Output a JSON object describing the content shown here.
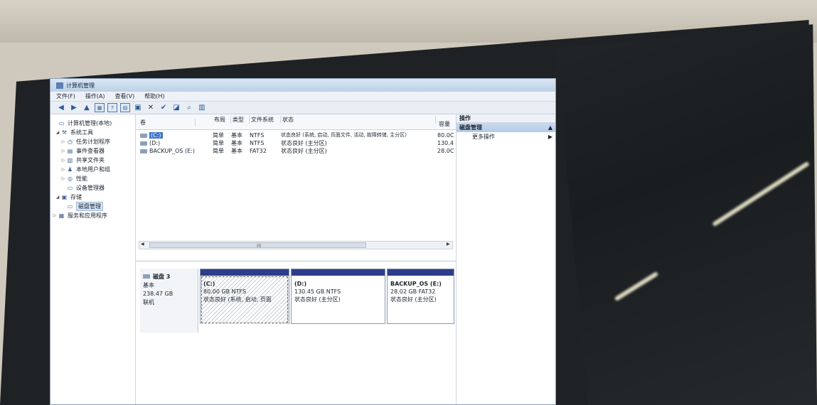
{
  "window": {
    "title": "计算机管理"
  },
  "menu": [
    "文件(F)",
    "操作(A)",
    "查看(V)",
    "帮助(H)"
  ],
  "toolbar_icons": [
    "back-arrow-icon",
    "forward-arrow-icon",
    "up-folder-icon",
    "console-tree-icon",
    "help-icon",
    "view-icon",
    "properties-icon",
    "delete-icon",
    "check-icon",
    "open-icon",
    "search-icon",
    "refresh-icon"
  ],
  "nav_tree": [
    {
      "label": "计算机管理(本地)",
      "icon": "computer-icon",
      "level": 0
    },
    {
      "label": "系统工具",
      "icon": "tools-icon",
      "level": 1
    },
    {
      "label": "任务计划程序",
      "icon": "clock-icon",
      "level": 2
    },
    {
      "label": "事件查看器",
      "icon": "event-icon",
      "level": 2
    },
    {
      "label": "共享文件夹",
      "icon": "folder-icon",
      "level": 2
    },
    {
      "label": "本地用户和组",
      "icon": "users-icon",
      "level": 2
    },
    {
      "label": "性能",
      "icon": "performance-icon",
      "level": 2
    },
    {
      "label": "设备管理器",
      "icon": "device-icon",
      "level": 2
    },
    {
      "label": "存储",
      "icon": "storage-icon",
      "level": 1
    },
    {
      "label": "磁盘管理",
      "icon": "disk-icon",
      "level": 2,
      "selected": true
    },
    {
      "label": "服务和应用程序",
      "icon": "services-icon",
      "level": 1
    }
  ],
  "volume_table": {
    "columns": [
      "卷",
      "布局",
      "类型",
      "文件系统",
      "状态",
      "容量"
    ],
    "rows": [
      {
        "volume": "(C:)",
        "layout": "简单",
        "type": "基本",
        "fs": "NTFS",
        "status": "状态良好 (系统, 启动, 页面文件, 活动, 故障转储, 主分区)",
        "capacity": "80.0C"
      },
      {
        "volume": "(D:)",
        "layout": "简单",
        "type": "基本",
        "fs": "NTFS",
        "status": "状态良好 (主分区)",
        "capacity": "130.4"
      },
      {
        "volume": "BACKUP_OS (E:)",
        "layout": "简单",
        "type": "基本",
        "fs": "FAT32",
        "status": "状态良好 (主分区)",
        "capacity": "28.0C"
      }
    ]
  },
  "scrollbar_grip": "III",
  "disk": {
    "name": "磁盘 3",
    "type": "基本",
    "size": "238.47 GB",
    "state": "联机",
    "partitions": [
      {
        "name": "(C:)",
        "size": "80.00 GB NTFS",
        "status": "状态良好 (系统, 启动, 页面",
        "bar_color": "#2d3d8c"
      },
      {
        "name": "(D:)",
        "size": "130.45 GB NTFS",
        "status": "状态良好 (主分区)",
        "bar_color": "#2d3d8c"
      },
      {
        "name": "BACKUP_OS (E:)",
        "size": "28.02 GB FAT32",
        "status": "状态良好 (主分区)",
        "bar_color": "#2d3d8c"
      }
    ]
  },
  "actions": {
    "header": "操作",
    "section": "磁盘管理",
    "more": "更多操作"
  }
}
